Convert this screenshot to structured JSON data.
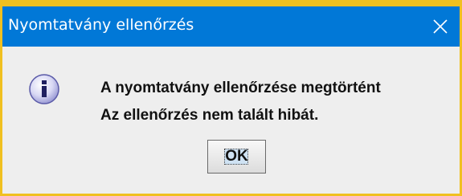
{
  "dialog": {
    "title": "Nyomtatvány ellenőrzés",
    "icon": "info-icon",
    "message_line1": "A nyomtatvány ellenőrzése megtörtént",
    "message_line2": "Az ellenőrzés nem talált hibát.",
    "ok_label": "OK",
    "close_icon": "close-icon"
  },
  "colors": {
    "titlebar": "#0178d7",
    "frame": "#f0c020",
    "background": "#eeeeee"
  }
}
